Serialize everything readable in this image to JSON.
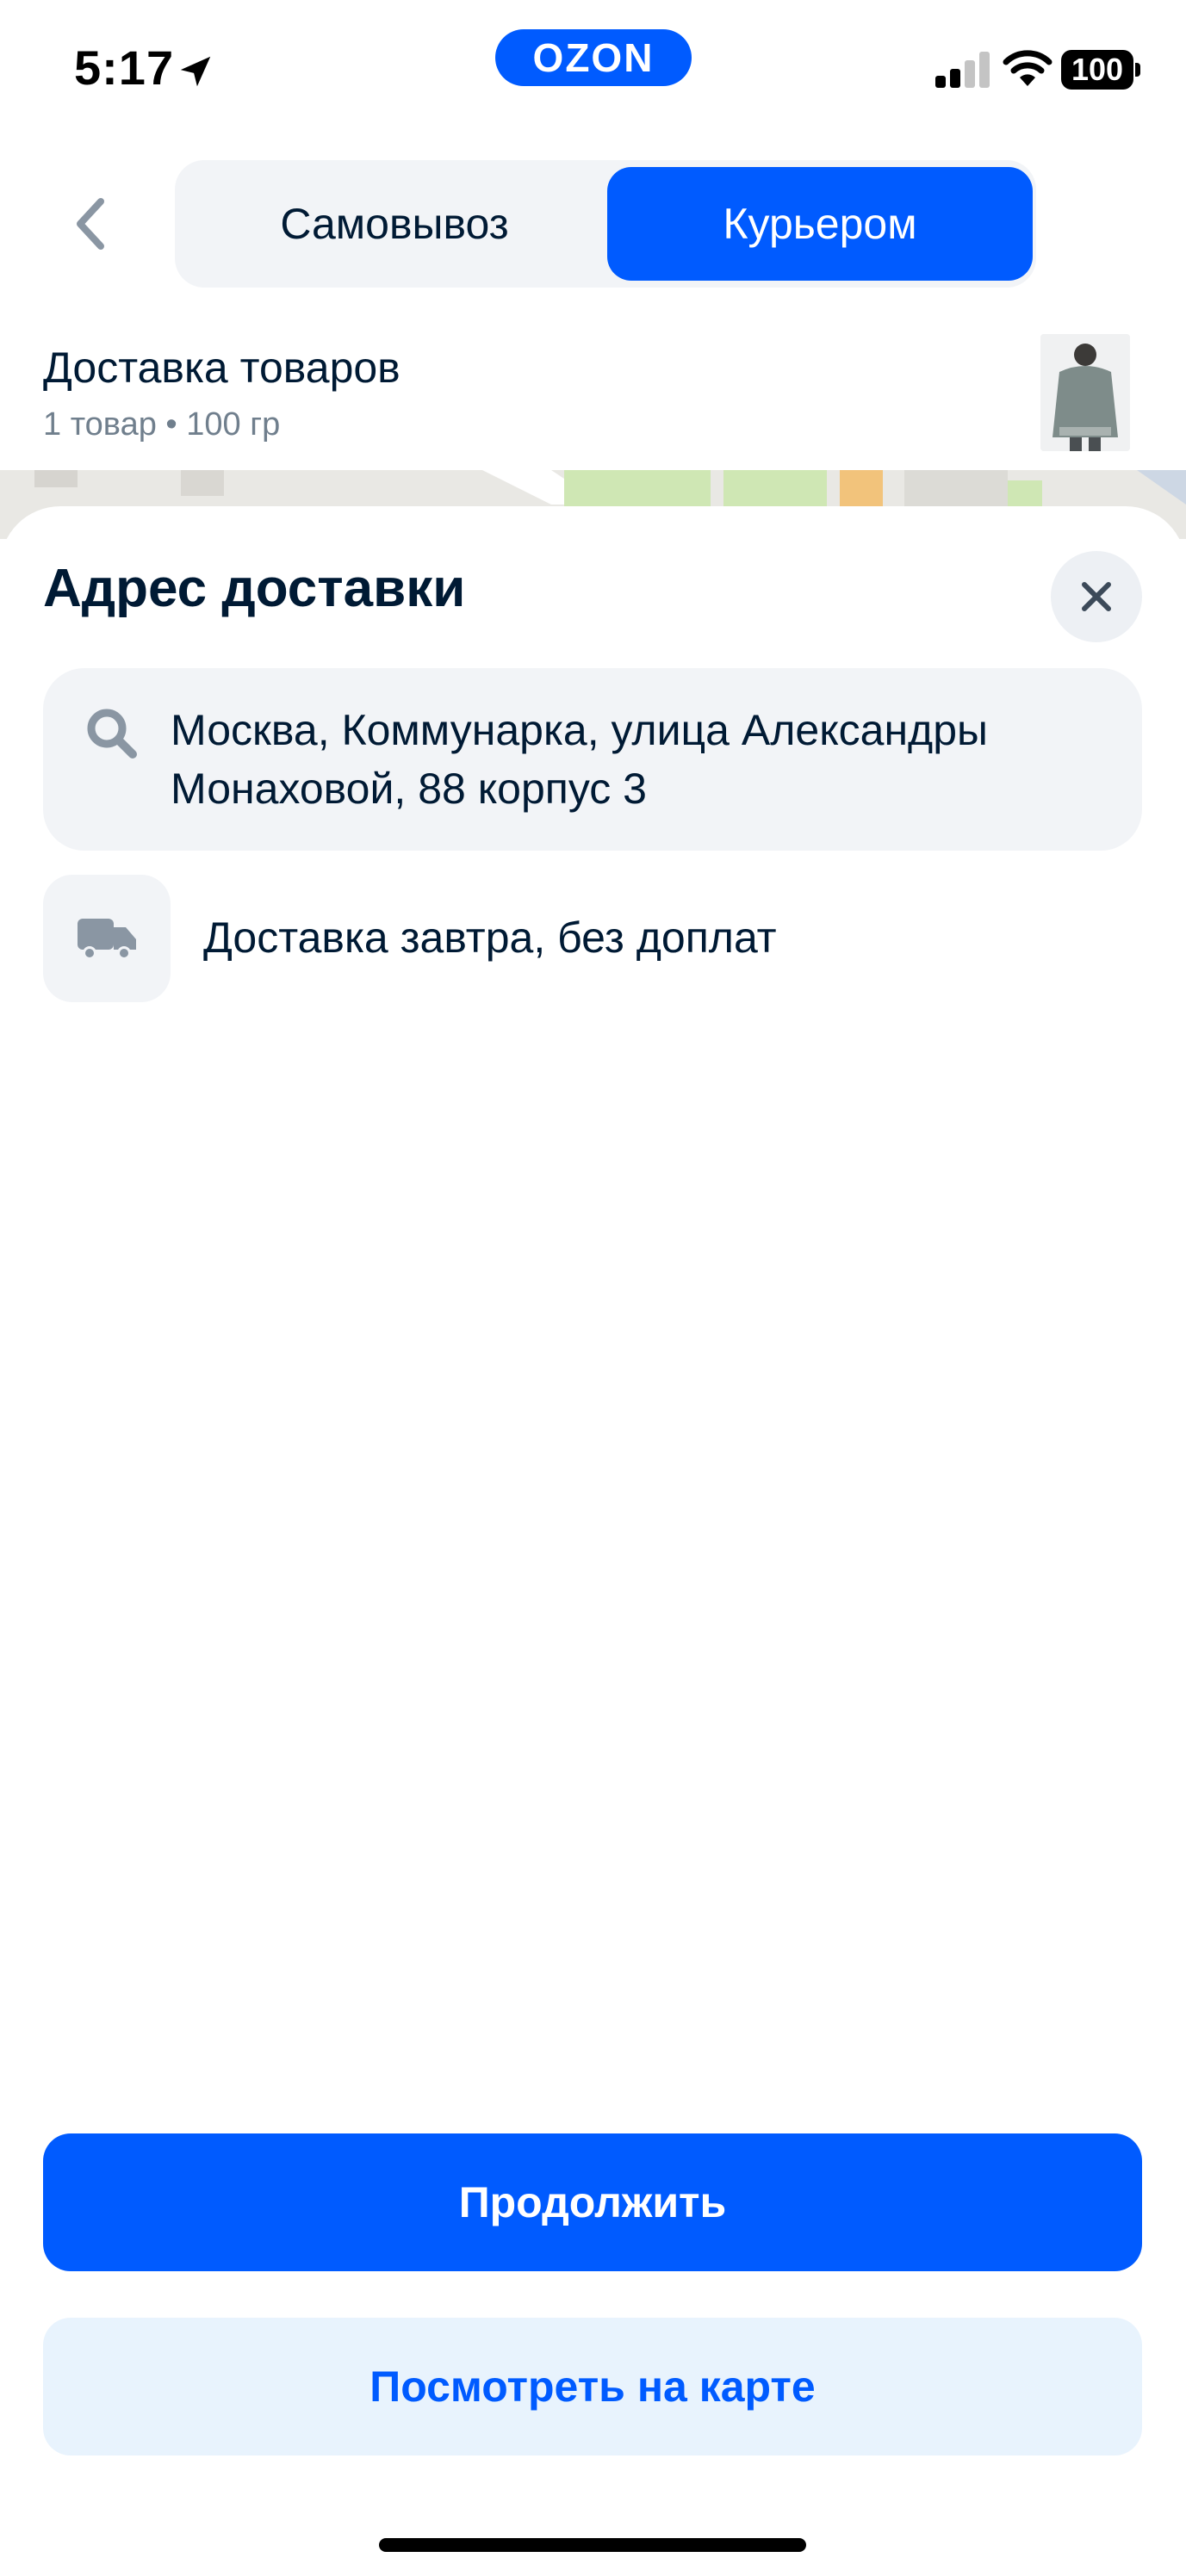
{
  "status_bar": {
    "time": "5:17",
    "brand": "OZON",
    "battery": "100",
    "icons": [
      "location-arrow-icon",
      "signal-icon",
      "wifi-icon",
      "battery-icon"
    ]
  },
  "tabs": {
    "items": [
      {
        "label": "Самовывоз",
        "selected": false
      },
      {
        "label": "Курьером",
        "selected": true
      }
    ]
  },
  "delivery_info": {
    "title": "Доставка товаров",
    "subtitle": "1 товар • 100 гр"
  },
  "sheet": {
    "title": "Адрес доставки",
    "address": "Москва, Коммунарка, улица Александры Монаховой, 88 корпус 3",
    "delivery_note": "Доставка завтра, без доплат"
  },
  "actions": {
    "continue": "Продолжить",
    "view_map": "Посмотреть на карте"
  },
  "colors": {
    "accent": "#005bff",
    "secondary_bg": "#e8f3fd",
    "field_bg": "#f2f4f7",
    "text": "#001a34",
    "muted": "#707f8d"
  }
}
